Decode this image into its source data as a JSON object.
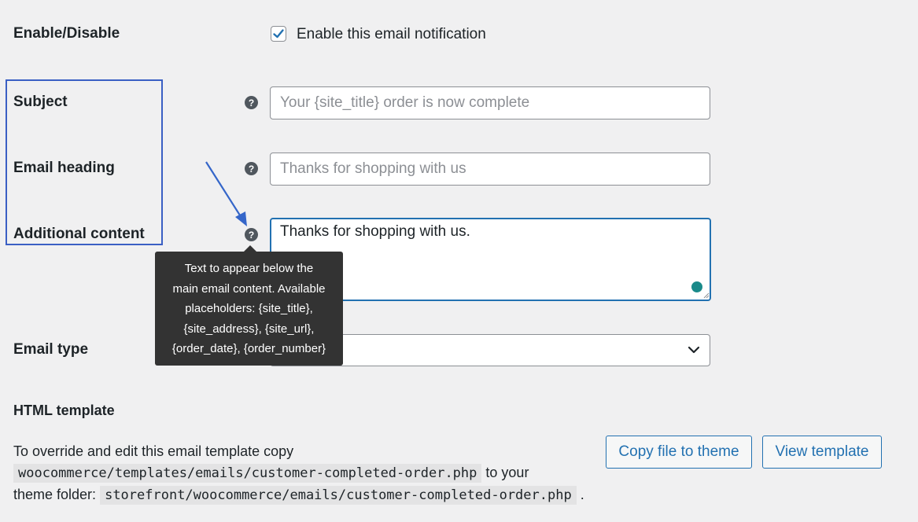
{
  "colors": {
    "background": "#f0f0f1",
    "accent": "#2271b1",
    "highlight_box": "#3a5fc4",
    "annotation_arrow": "#3566c9",
    "tooltip_bg": "#333333",
    "resize_dot": "#1a8a8a"
  },
  "fields": {
    "enable": {
      "label": "Enable/Disable",
      "checkbox_label": "Enable this email notification",
      "checked": true,
      "checkbox_icon": "checkmark-icon"
    },
    "subject": {
      "label": "Subject",
      "placeholder": "Your {site_title} order is now complete",
      "value": "",
      "help_icon": "question-mark-icon"
    },
    "heading": {
      "label": "Email heading",
      "placeholder": "Thanks for shopping with us",
      "value": "",
      "help_icon": "question-mark-icon"
    },
    "additional": {
      "label": "Additional content",
      "value": "Thanks for shopping with us.",
      "help_icon": "question-mark-icon"
    },
    "email_type": {
      "label": "Email type",
      "dropdown_icon": "chevron-down-icon"
    }
  },
  "tooltip": {
    "lines": [
      "Text to appear below the",
      "main email content. Available",
      "placeholders: {site_title},",
      "{site_address}, {site_url},",
      "{order_date}, {order_number}"
    ]
  },
  "html_template": {
    "heading": "HTML template",
    "text_before": "To override and edit this email template copy",
    "code_template": "woocommerce/templates/emails/customer-completed-order.php",
    "text_middle": "to your",
    "text_theme": "theme folder:",
    "code_theme": "storefront/woocommerce/emails/customer-completed-order.php",
    "text_end": ".",
    "copy_button": "Copy file to theme",
    "view_button": "View template"
  }
}
